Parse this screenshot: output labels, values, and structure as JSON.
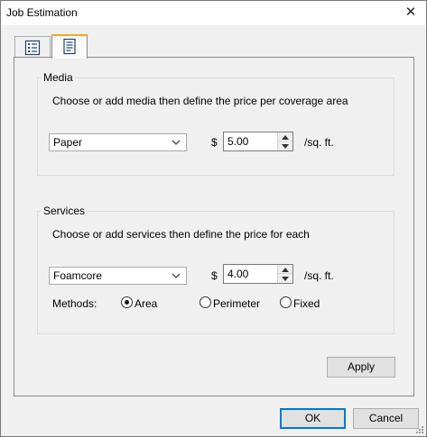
{
  "window": {
    "title": "Job Estimation",
    "close_glyph": "✕"
  },
  "tabs": [
    {
      "icon": "checklist-icon",
      "selected": false
    },
    {
      "icon": "document-list-icon",
      "selected": true
    }
  ],
  "media": {
    "group_label": "Media",
    "instructions": "Choose or add media then define the price per coverage area",
    "selected_media": "Paper",
    "currency": "$",
    "price": "5.00",
    "unit": "/sq. ft."
  },
  "services": {
    "group_label": "Services",
    "instructions": "Choose or add services then define the price for each",
    "selected_service": "Foamcore",
    "currency": "$",
    "price": "4.00",
    "unit": "/sq. ft.",
    "methods_label": "Methods:",
    "methods": [
      {
        "label": "Area",
        "checked": true
      },
      {
        "label": "Perimeter",
        "checked": false
      },
      {
        "label": "Fixed",
        "checked": false
      }
    ]
  },
  "buttons": {
    "apply": "Apply",
    "ok": "OK",
    "cancel": "Cancel"
  },
  "colors": {
    "accent": "#0078d7",
    "selected_tab_highlight": "#f5a623",
    "dialog_background": "#f0f0f0"
  }
}
